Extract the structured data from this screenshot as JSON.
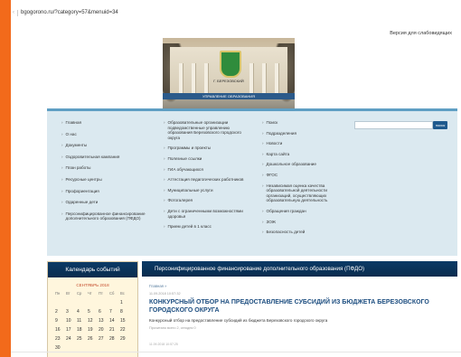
{
  "browser": {
    "url": "bgogorono.ru/?category=57&menuid=34",
    "back_glyph": "‹"
  },
  "header": {
    "low_vision_label": "Версия для слабовидящих"
  },
  "banner": {
    "city": "Г. БЕРЕЗОВСКИЙ",
    "strip": "УПРАВЛЕНИЕ ОБРАЗОВАНИЯ"
  },
  "menu": {
    "arrow": "›",
    "col1": [
      "Главная",
      "О нас",
      "Документы",
      "Оздоровительная кампания",
      "План работы",
      "Ресурсные центры",
      "Профориентация",
      "Одаренные дети",
      "Персонифицированное финансирование дополнительного образования (ПФДО)"
    ],
    "col2": [
      "Образовательные организации подведомственные управлению образования Березовского городского округа",
      "Программы и проекты",
      "Полезные ссылки",
      "ГИА обучающихся",
      "Аттестация педагогических работников",
      "Муниципальные услуги",
      "Фотогалерея",
      "Дети с ограниченными возможностями здоровья",
      "Прием детей в 1 класс"
    ],
    "col3": [
      "Поиск",
      "Подразделения",
      "Новости",
      "Карта сайта",
      "Дошкольное образование",
      "ФГОС",
      "Независимая оценка качества образовательной деятельности организаций, осуществляющих образовательную деятельность",
      "Обращения граждан",
      "ЗОЖ",
      "Безопасность детей"
    ],
    "search_button": "поиск"
  },
  "calendar": {
    "title": "Календарь событий",
    "month": "СЕНТЯБРЬ 2018",
    "day_names": [
      "Пн",
      "Вт",
      "Ср",
      "Чт",
      "Пт",
      "Сб",
      "Вс"
    ],
    "leading_blanks": 6,
    "days": [
      "1",
      "2",
      "3",
      "4",
      "5",
      "6",
      "7",
      "8",
      "9",
      "10",
      "11",
      "12",
      "13",
      "14",
      "15",
      "16",
      "17",
      "18",
      "19",
      "20",
      "21",
      "22",
      "23",
      "24",
      "25",
      "26",
      "27",
      "28",
      "29",
      "30"
    ]
  },
  "article": {
    "section_title": "Персонифицированное финансирование дополнительного образования (ПФДО)",
    "breadcrumb": "Главная  »",
    "date": "11.09.2018 10:57:32",
    "title": "КОНКУРСНЫЙ ОТБОР НА ПРЕДОСТАВЛЕНИЕ СУБСИДИЙ ИЗ БЮДЖЕТА БЕРЕЗОВСКОГО ГОРОДСКОГО ОКРУГА",
    "summary": "Конкурсный отбор на предоставление субсидий из бюджета Березовского городского округа",
    "meta": "Прочитано всего 2, сегодня 0",
    "meta2": "11.09.2018 10:57:25"
  }
}
